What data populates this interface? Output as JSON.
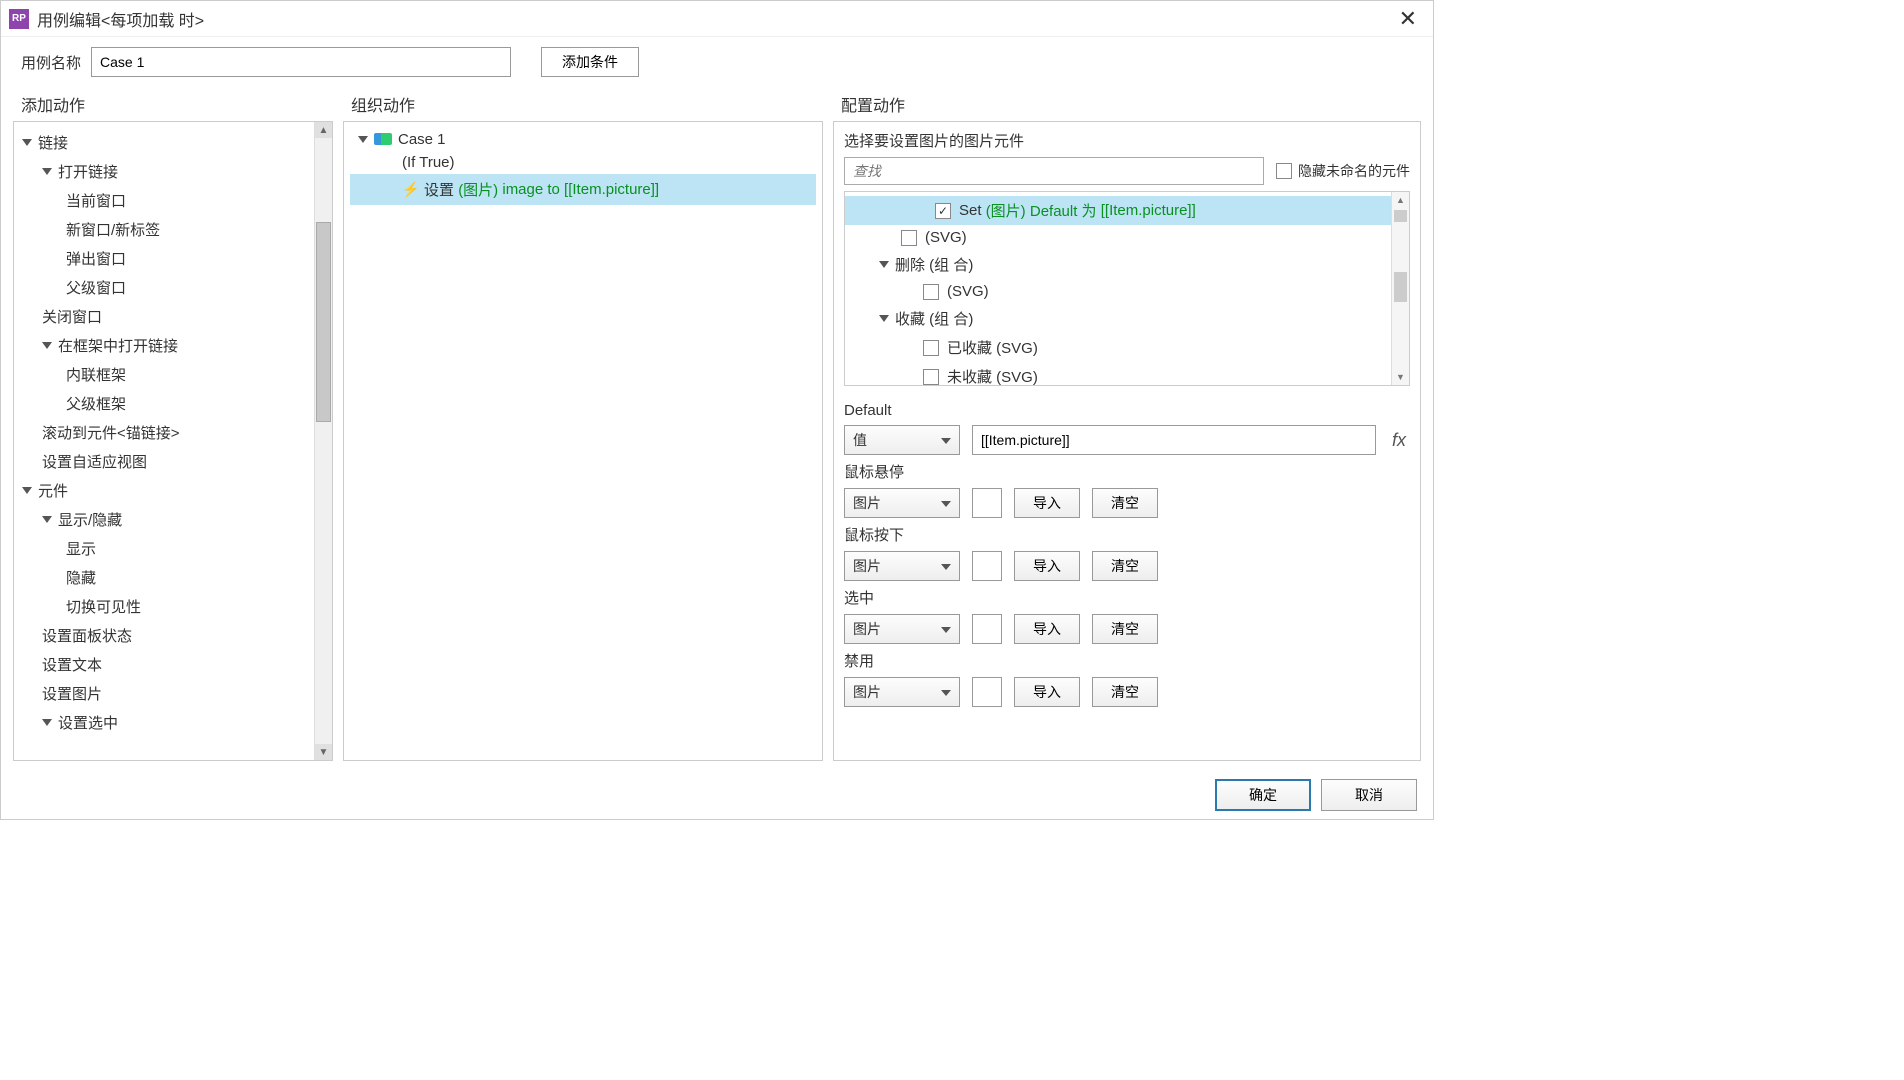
{
  "title": "用例编辑<每项加载 时>",
  "app_icon_text": "RP",
  "name_row": {
    "label": "用例名称",
    "value": "Case 1",
    "add_condition_btn": "添加条件"
  },
  "section_headers": {
    "add": "添加动作",
    "organize": "组织动作",
    "configure": "配置动作"
  },
  "action_tree": {
    "links": {
      "label": "链接",
      "open_link": {
        "label": "打开链接",
        "children": [
          "当前窗口",
          "新窗口/新标签",
          "弹出窗口",
          "父级窗口"
        ]
      },
      "close_window": "关闭窗口",
      "open_in_frame": {
        "label": "在框架中打开链接",
        "children": [
          "内联框架",
          "父级框架"
        ]
      },
      "scroll_to": "滚动到元件<锚链接>",
      "set_adaptive": "设置自适应视图"
    },
    "widgets": {
      "label": "元件",
      "show_hide": {
        "label": "显示/隐藏",
        "children": [
          "显示",
          "隐藏",
          "切换可见性"
        ]
      },
      "set_panel_state": "设置面板状态",
      "set_text": "设置文本",
      "set_image": "设置图片",
      "set_selected": "设置选中"
    }
  },
  "organize": {
    "case_name": "Case 1",
    "condition": "(If True)",
    "action_prefix": "设置",
    "action_target": "(图片)",
    "action_suffix": "image to [[Item.picture]]"
  },
  "configure": {
    "header": "选择要设置图片的图片元件",
    "search_placeholder": "查找",
    "hide_unnamed_label": "隐藏未命名的元件",
    "elements": {
      "row1_prefix": "Set",
      "row1_target": "(图片)",
      "row1_mid": "Default 为",
      "row1_value": "[[Item.picture]]",
      "row2": "(SVG)",
      "row3": "删除 (组 合)",
      "row4": "(SVG)",
      "row5": "收藏 (组 合)",
      "row6": "已收藏 (SVG)",
      "row7": "未收藏 (SVG)"
    },
    "default_section": {
      "label": "Default",
      "dropdown": "值",
      "input_value": "[[Item.picture]]",
      "fx": "fx"
    },
    "states": [
      {
        "label": "鼠标悬停",
        "dropdown": "图片",
        "import_btn": "导入",
        "clear_btn": "清空"
      },
      {
        "label": "鼠标按下",
        "dropdown": "图片",
        "import_btn": "导入",
        "clear_btn": "清空"
      },
      {
        "label": "选中",
        "dropdown": "图片",
        "import_btn": "导入",
        "clear_btn": "清空"
      },
      {
        "label": "禁用",
        "dropdown": "图片",
        "import_btn": "导入",
        "clear_btn": "清空"
      }
    ]
  },
  "footer": {
    "ok": "确定",
    "cancel": "取消"
  }
}
